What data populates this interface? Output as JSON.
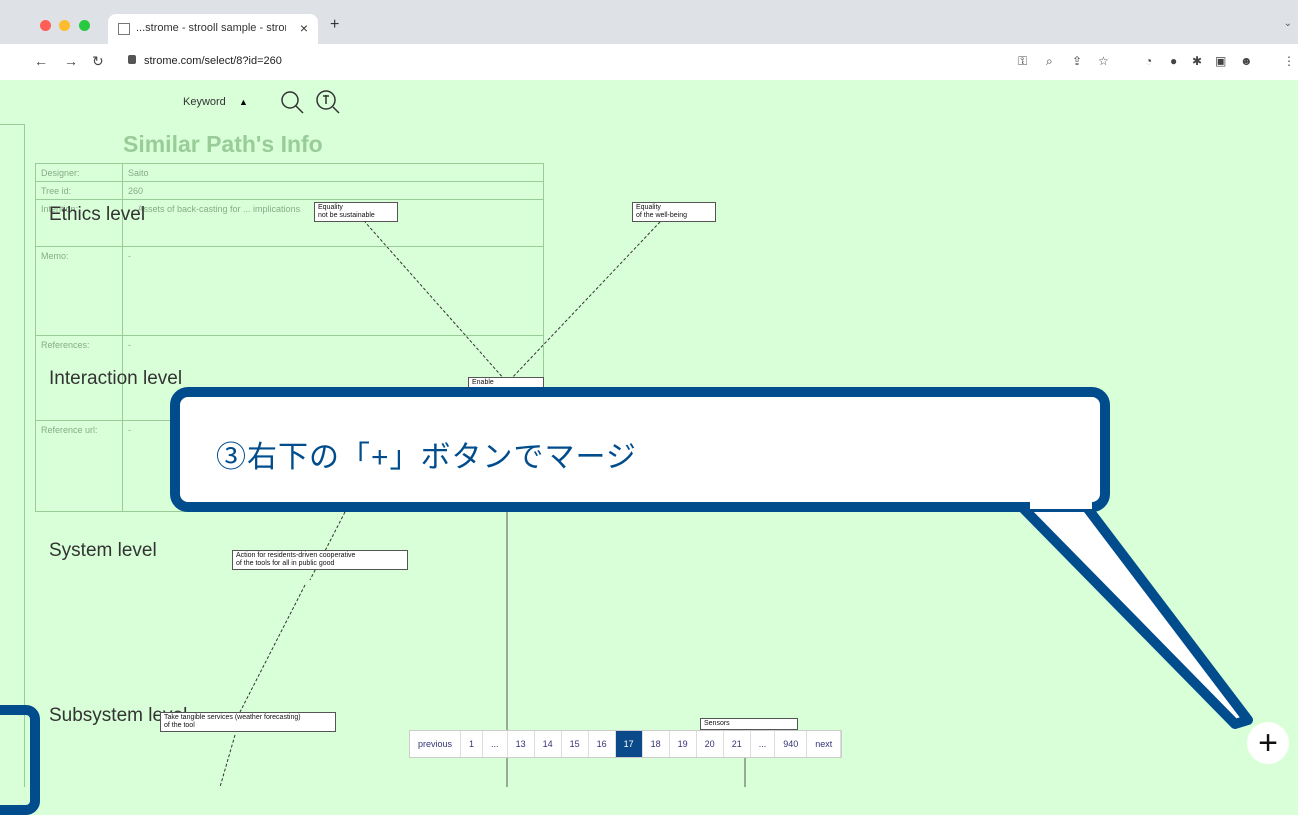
{
  "browser": {
    "tab_title": "...strome - strooll sample - strom",
    "tab_close": "×",
    "new_tab": "+",
    "url": "strome.com/select/8?id=260",
    "back": "←",
    "forward": "→",
    "reload": "↻"
  },
  "app": {
    "keyword_label": "Keyword",
    "keyword_caret": "▲"
  },
  "info": {
    "title": "Similar Path's Info",
    "rows": [
      {
        "k": "Designer:",
        "v": "Saito"
      },
      {
        "k": "Tree id:",
        "v": "260"
      },
      {
        "k": "Intention:",
        "v": "... Assets of back-casting for ... implications"
      },
      {
        "k": "Memo:",
        "v": "-"
      },
      {
        "k": "References:",
        "v": "-"
      },
      {
        "k": "Reference url:",
        "v": "-"
      }
    ]
  },
  "levels": {
    "ethics": "Ethics level",
    "interaction": "Interaction level",
    "system": "System level",
    "subsystem": "Subsystem level"
  },
  "nodes": {
    "n1": "Equality\nnot be sustainable",
    "n2": "Equality\nof the well-being",
    "n3": "Enable",
    "n4": "Action for residents-driven cooperative\nof the tools for all in public good",
    "n5": "Take tangible services (weather forecasting)\nof the tool",
    "n6": "Sensors"
  },
  "pager": [
    "previous",
    "1",
    "...",
    "13",
    "14",
    "15",
    "16",
    "17",
    "18",
    "19",
    "20",
    "21",
    "...",
    "940",
    "next"
  ],
  "pager_active": "17",
  "merge_button": "+",
  "callout": "③右下の「+」ボタンでマージ",
  "colors": {
    "accent": "#004c8c",
    "graph_bg": "#d8ffd8"
  }
}
